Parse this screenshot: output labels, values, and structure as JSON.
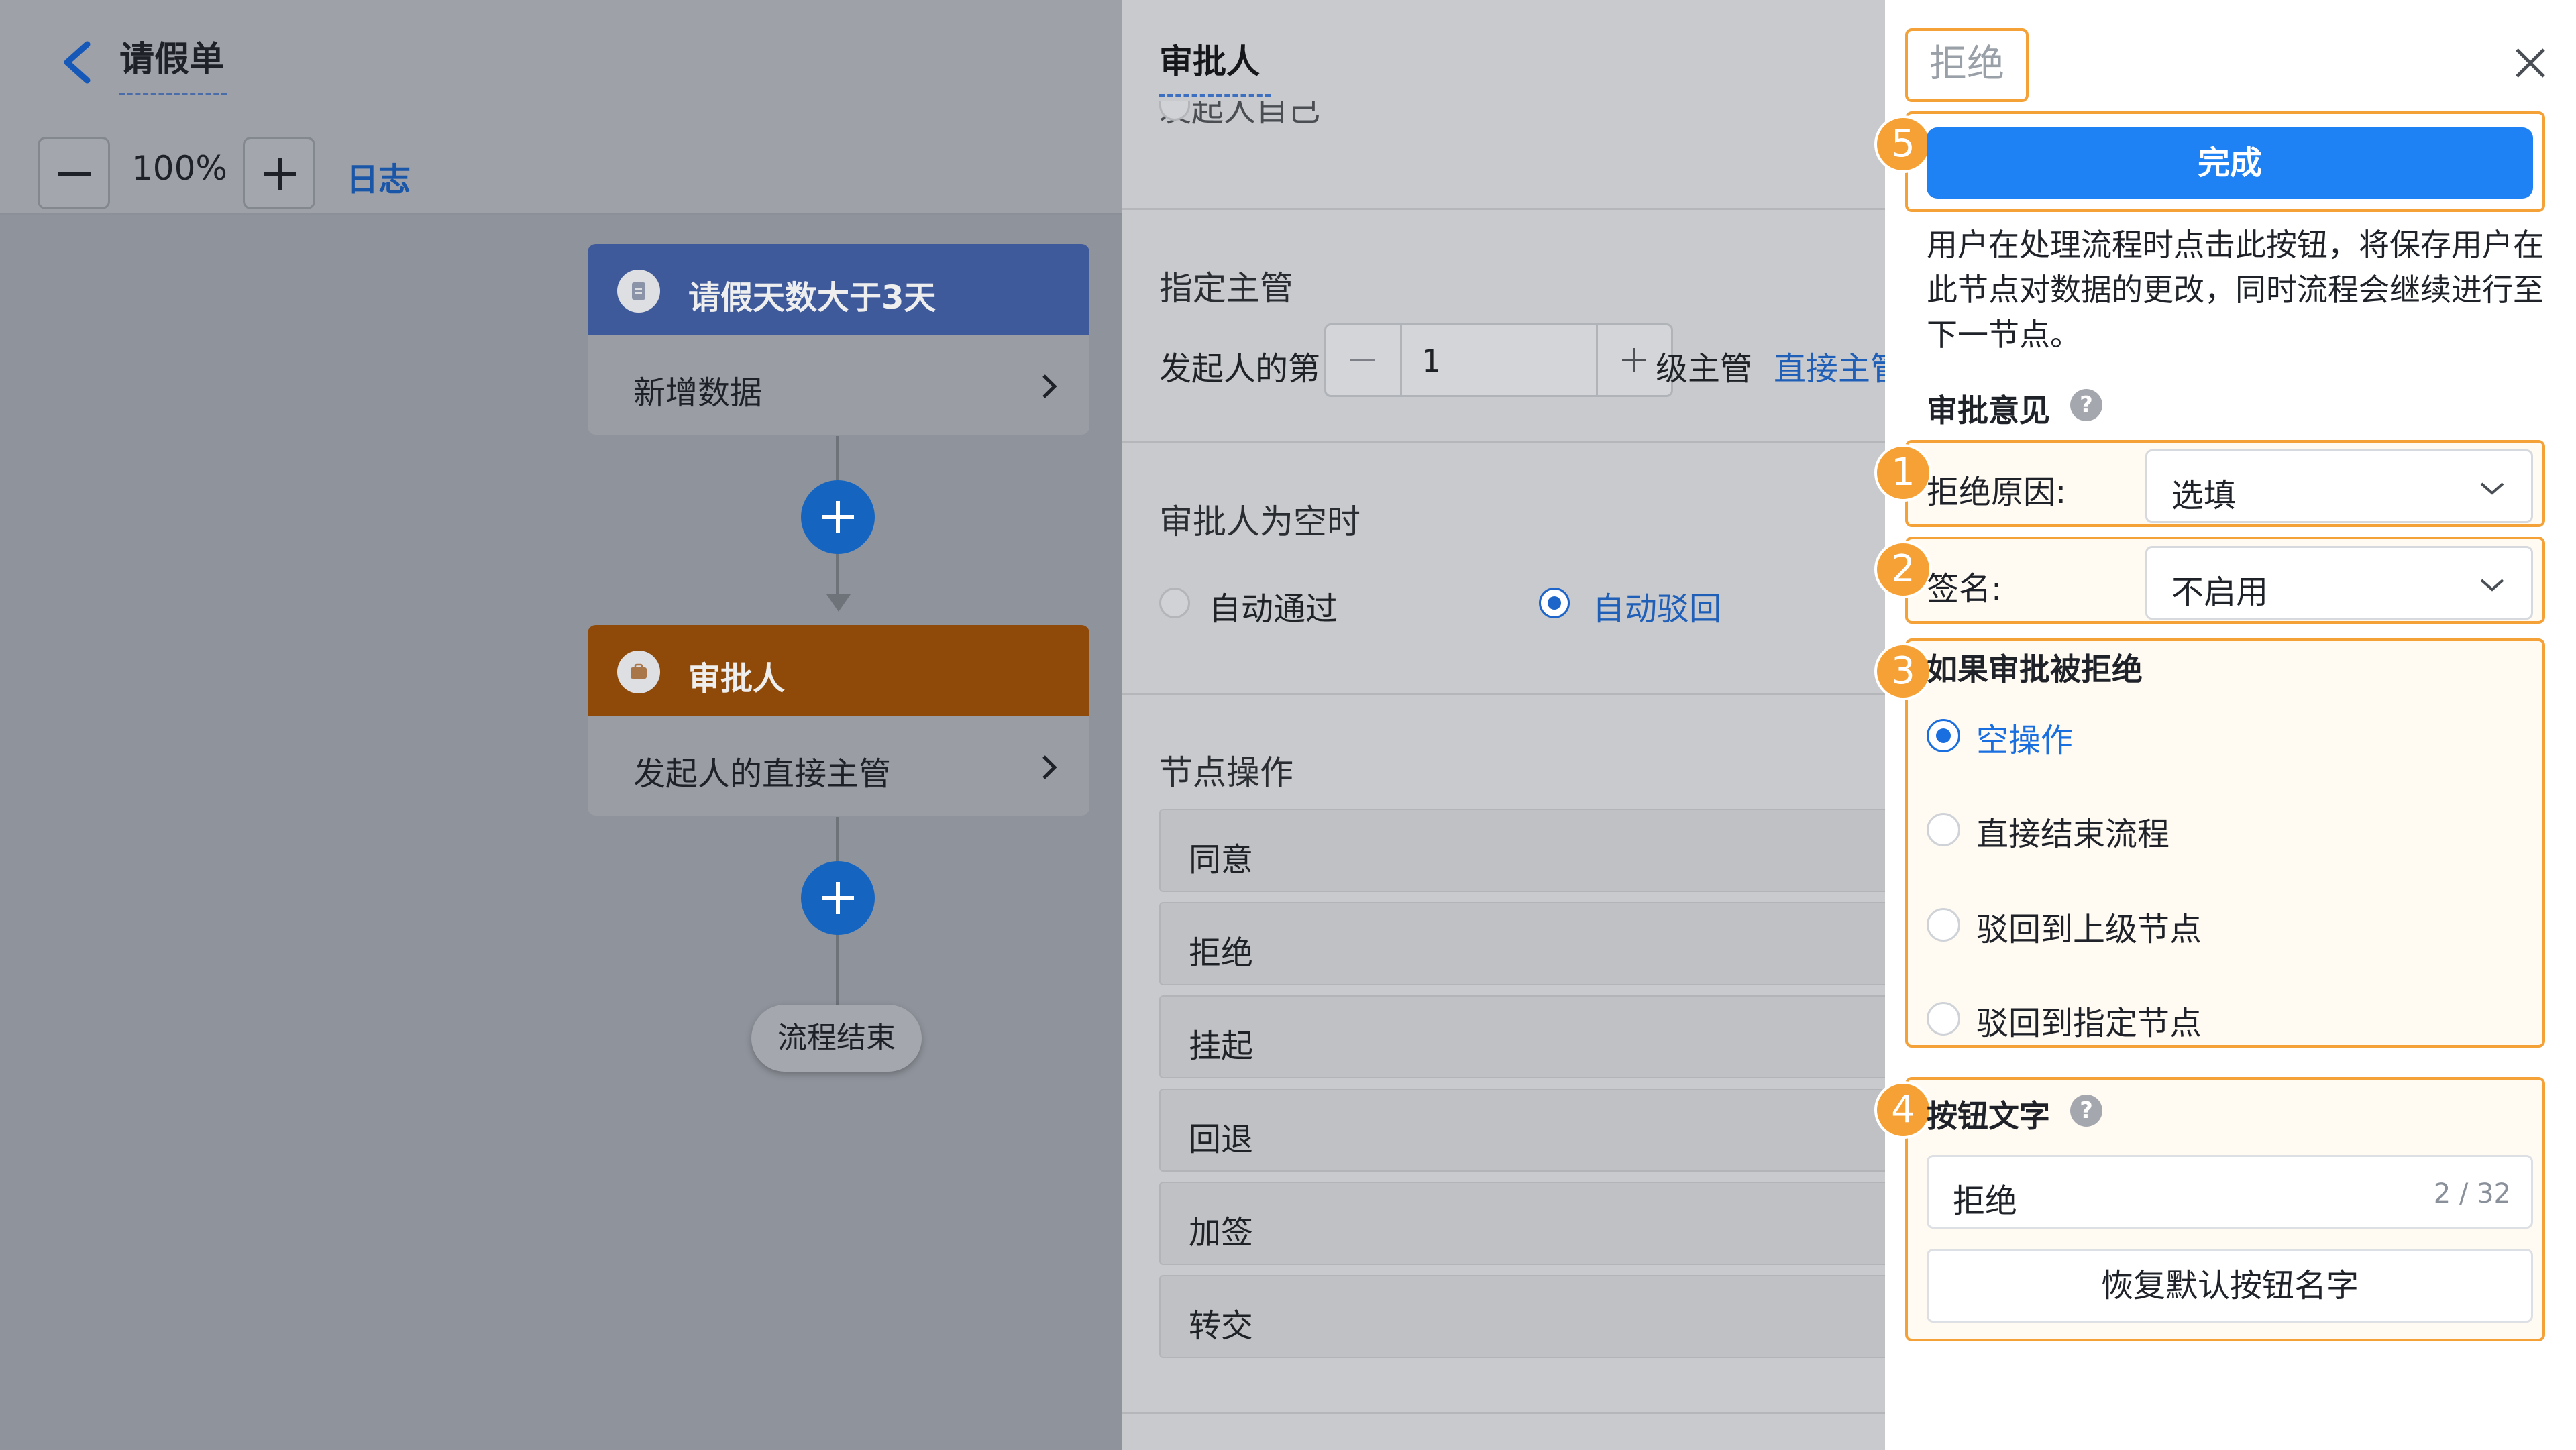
{
  "canvas": {
    "title": "请假单",
    "zoom": "100%",
    "log_link": "日志",
    "nodes": [
      {
        "title": "请假天数大于3天",
        "body": "新增数据",
        "head_color": "#3f5a9b",
        "body_color": "#9a9da4"
      },
      {
        "title": "审批人",
        "body": "发起人的直接主管",
        "head_color": "#8f4a0a",
        "body_color": "#9a9da4"
      }
    ],
    "end_label": "流程结束"
  },
  "middle": {
    "title": "审批人",
    "clipped_option": "发起人自己",
    "section_supervisor": "指定主管",
    "supervisor_prefix": "发起人的第",
    "supervisor_level": "1",
    "supervisor_suffix": "级主管",
    "supervisor_link": "直接主管",
    "section_empty": "审批人为空时",
    "empty_options": [
      {
        "label": "自动通过",
        "selected": false
      },
      {
        "label": "自动驳回",
        "selected": true
      }
    ],
    "section_ops": "节点操作",
    "operations": [
      "同意",
      "拒绝",
      "挂起",
      "回退",
      "加签",
      "转交"
    ]
  },
  "panel": {
    "tab_label": "拒绝",
    "done_button": "完成",
    "description": "用户在处理流程时点击此按钮，将保存用户在此节点对数据的更改，同时流程会继续进行至下一节点。",
    "opinion_label": "审批意见",
    "reject_reason_label": "拒绝原因:",
    "reject_reason_value": "选填",
    "signature_label": "签名:",
    "signature_value": "不启用",
    "if_rejected_label": "如果审批被拒绝",
    "reject_options": [
      {
        "label": "空操作",
        "selected": true
      },
      {
        "label": "直接结束流程",
        "selected": false
      },
      {
        "label": "驳回到上级节点",
        "selected": false
      },
      {
        "label": "驳回到指定节点",
        "selected": false
      }
    ],
    "button_text_label": "按钮文字",
    "button_text_value": "拒绝",
    "button_text_count": "2 / 32",
    "reset_button": "恢复默认按钮名字",
    "badges": [
      "1",
      "2",
      "3",
      "4",
      "5"
    ],
    "help_glyph": "?",
    "accent_color": "#1e82f5",
    "highlight_color": "#f4a237"
  }
}
